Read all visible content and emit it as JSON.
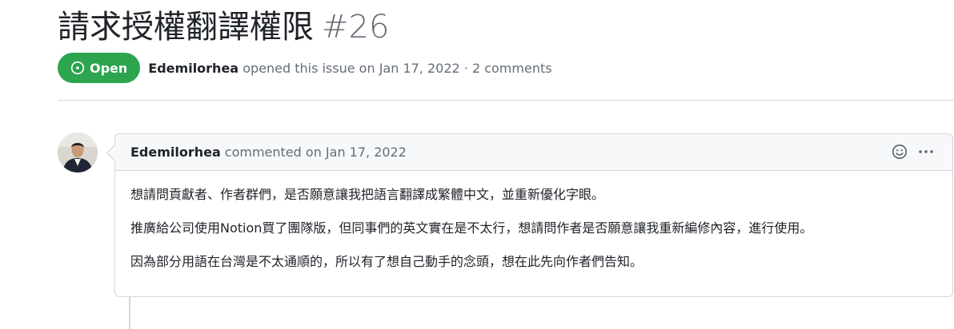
{
  "issue": {
    "title": "請求授權翻譯權限",
    "number": "#26",
    "state": "Open",
    "author": "Edemilorhea",
    "opened_text": "opened this issue on Jan 17, 2022 · 2 comments"
  },
  "comment": {
    "author": "Edemilorhea",
    "meta": "commented on Jan 17, 2022",
    "paragraphs": [
      "想請問貢獻者、作者群們，是否願意讓我把語言翻譯成繁體中文，並重新優化字眼。",
      "推廣給公司使用Notion買了團隊版，但同事們的英文實在是不太行，想請問作者是否願意讓我重新編修內容，進行使用。",
      "因為部分用語在台灣是不太通順的，所以有了想自己動手的念頭，想在此先向作者們告知。"
    ]
  },
  "icons": {
    "state": "issue-open-icon",
    "reaction": "smiley-icon",
    "menu": "kebab-horizontal-icon"
  },
  "colors": {
    "open_badge": "#2da44e",
    "border": "#d0d7de",
    "muted_text": "#656d76"
  }
}
